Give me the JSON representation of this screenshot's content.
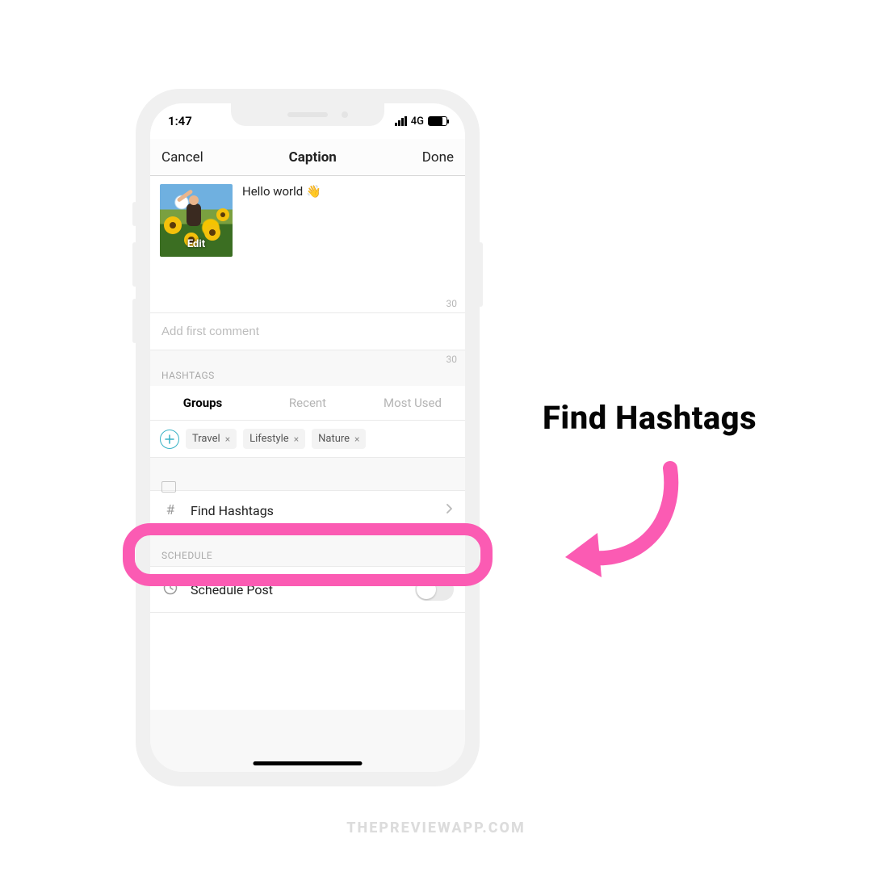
{
  "status": {
    "time": "1:47",
    "network": "4G"
  },
  "nav": {
    "cancel": "Cancel",
    "title": "Caption",
    "done": "Done"
  },
  "caption": {
    "text": "Hello world 👋",
    "edit_label": "Edit",
    "counter": "30"
  },
  "first_comment": {
    "placeholder": "Add first comment",
    "counter": "30"
  },
  "sections": {
    "hashtags": "HASHTAGS",
    "schedule": "SCHEDULE"
  },
  "tabs": {
    "groups": "Groups",
    "recent": "Recent",
    "most_used": "Most Used"
  },
  "chips": [
    "Travel",
    "Lifestyle",
    "Nature"
  ],
  "find": {
    "label": "Find Hashtags"
  },
  "schedule": {
    "label": "Schedule Post"
  },
  "annotation": {
    "label": "Find Hashtags"
  },
  "watermark": "THEPREVIEWAPP.COM",
  "colors": {
    "highlight": "#fb5bb3",
    "accent": "#38b2c5"
  }
}
